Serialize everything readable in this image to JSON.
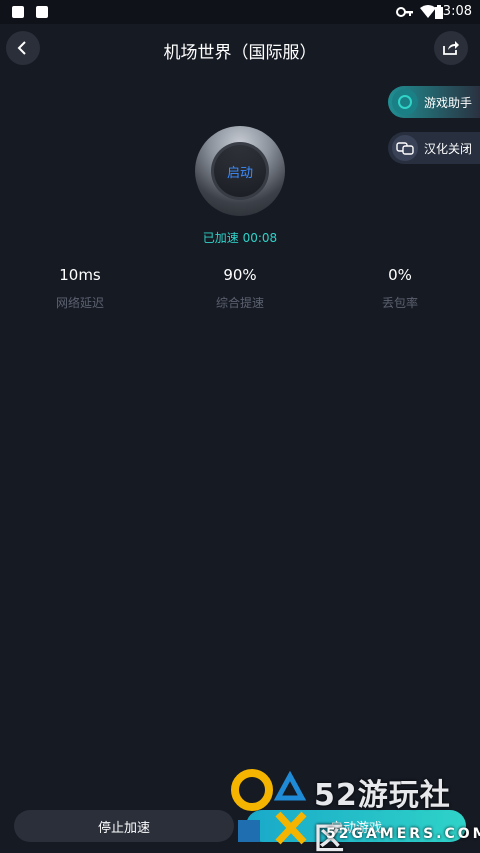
{
  "status_bar": {
    "time": "3:08"
  },
  "header": {
    "title": "机场世界（国际服）"
  },
  "side_actions": [
    {
      "label": "游戏助手",
      "icon": "assistant-ring-icon",
      "color": "#2fd3c8"
    },
    {
      "label": "汉化关闭",
      "icon": "translate-icon",
      "color": "#3a57c9"
    }
  ],
  "game": {
    "launch_label": "启动",
    "accel_status": "已加速 00:08"
  },
  "stats": [
    {
      "value": "10ms",
      "label": "网络延迟"
    },
    {
      "value": "90%",
      "label": "综合提速"
    },
    {
      "value": "0%",
      "label": "丢包率"
    }
  ],
  "bottom": {
    "stop_label": "停止加速",
    "start_label": "启动游戏"
  },
  "watermark": {
    "text": "52游玩社区",
    "sub": "52GAMERS.COM"
  },
  "colors": {
    "background": "#161a23",
    "accent": "#2fd3c8",
    "button_dark": "#2a2f3a"
  }
}
